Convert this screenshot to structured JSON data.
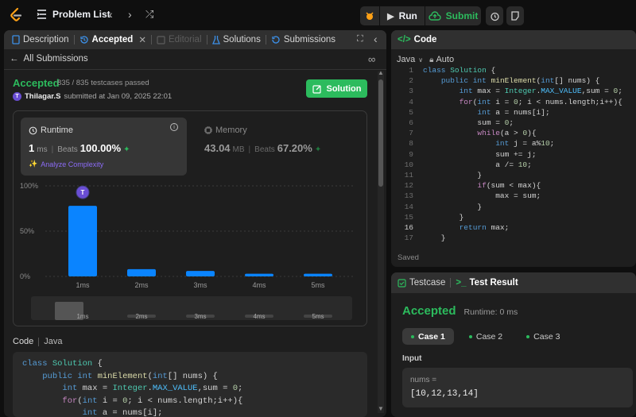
{
  "topbar": {
    "problem_list_label": "Problem List",
    "run_label": "Run",
    "submit_label": "Submit"
  },
  "left_tabs": {
    "description": "Description",
    "accepted": "Accepted",
    "editorial": "Editorial",
    "solutions": "Solutions",
    "submissions": "Submissions"
  },
  "submission": {
    "back_label": "All Submissions",
    "status": "Accepted",
    "testcases": "835 / 835 testcases passed",
    "user_initial": "T",
    "user": "Thilagar.S",
    "submitted_at": "submitted at Jan 09, 2025 22:01",
    "solution_button": "Solution"
  },
  "runtime": {
    "label": "Runtime",
    "value": "1",
    "unit": "ms",
    "beats_label": "Beats",
    "beats": "100.00%",
    "analyze": "Analyze Complexity"
  },
  "memory": {
    "label": "Memory",
    "value": "43.04",
    "unit": "MB",
    "beats_label": "Beats",
    "beats": "67.20%"
  },
  "chart_data": {
    "type": "bar",
    "categories": [
      "1ms",
      "2ms",
      "3ms",
      "4ms",
      "5ms"
    ],
    "values": [
      78,
      8,
      6,
      3,
      3
    ],
    "yticks": [
      "100%",
      "50%",
      "0%"
    ],
    "ylim": [
      0,
      100
    ],
    "marker_initial": "T",
    "marker_category": "1ms",
    "mini_categories": [
      "1ms",
      "2ms",
      "3ms",
      "4ms",
      "5ms"
    ]
  },
  "code_section": {
    "title": "Code",
    "language": "Java",
    "lines": [
      "class Solution {",
      "    public int minElement(int[] nums) {",
      "        int max = Integer.MAX_VALUE,sum = 0;",
      "        for(int i = 0; i < nums.length;i++){",
      "            int a = nums[i];"
    ]
  },
  "editor": {
    "title": "Code",
    "language": "Java",
    "auto": "Auto",
    "saved": "Saved",
    "line_numbers": [
      "1",
      "2",
      "3",
      "4",
      "5",
      "6",
      "7",
      "8",
      "9",
      "10",
      "11",
      "12",
      "13",
      "14",
      "15",
      "16",
      "17"
    ],
    "lines": [
      "class Solution {",
      "    public int minElement(int[] nums) {",
      "        int max = Integer.MAX_VALUE,sum = 0;",
      "        for(int i = 0; i < nums.length;i++){",
      "            int a = nums[i];",
      "            sum = 0;",
      "            while(a > 0){",
      "                int j = a%10;",
      "                sum += j;",
      "                a /= 10;",
      "            }",
      "            if(sum < max){",
      "                max = sum;",
      "            }",
      "        }",
      "        return max;",
      "    }"
    ]
  },
  "result": {
    "testcase_tab": "Testcase",
    "result_tab": "Test Result",
    "status": "Accepted",
    "runtime": "Runtime: 0 ms",
    "cases": [
      "Case 1",
      "Case 2",
      "Case 3"
    ],
    "input_label": "Input",
    "param_name": "nums =",
    "param_value": "[10,12,13,14]"
  },
  "colors": {
    "accepted": "#2cbb5d",
    "bar": "#0a84ff",
    "link": "#8c6cf7"
  }
}
